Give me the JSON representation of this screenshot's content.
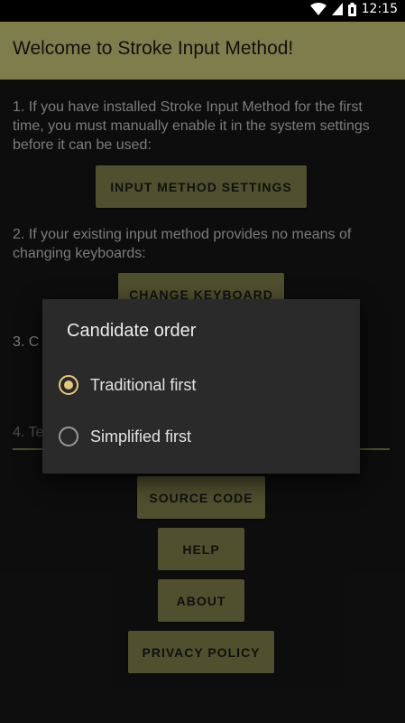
{
  "status_bar": {
    "time": "12:15"
  },
  "app_bar": {
    "title": "Welcome to Stroke Input Method!"
  },
  "content": {
    "step1": "1. If you have installed Stroke Input Method for the first time, you must manually enable it in the system settings before it can be used:",
    "step1_button": "INPUT METHOD SETTINGS",
    "step2": "2. If your existing input method provides no means of changing keyboards:",
    "step2_button": "CHANGE KEYBOARD",
    "step3_partial": "3. C",
    "input_partial": "4. Te",
    "buttons": {
      "source_code": "SOURCE CODE",
      "help": "HELP",
      "about": "ABOUT",
      "privacy_policy": "PRIVACY POLICY"
    }
  },
  "dialog": {
    "title": "Candidate order",
    "options": [
      {
        "label": "Traditional first",
        "selected": true
      },
      {
        "label": "Simplified first",
        "selected": false
      }
    ]
  },
  "colors": {
    "accent": "#7b7a48",
    "radio_selected": "#e6c87a"
  }
}
